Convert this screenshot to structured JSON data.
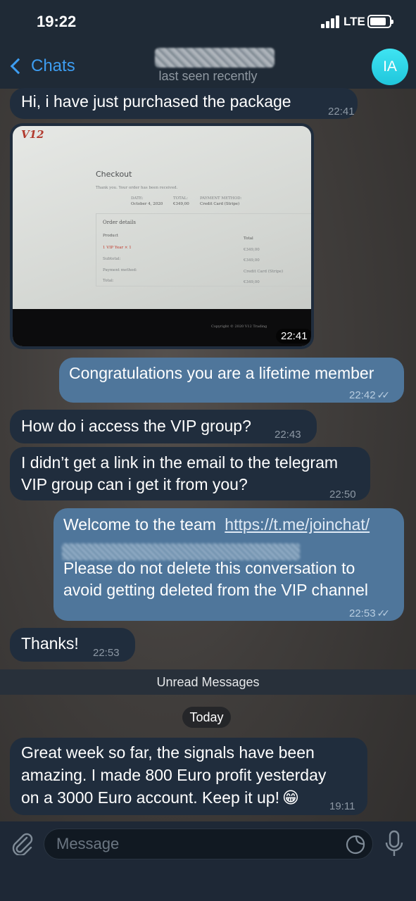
{
  "status_bar": {
    "time": "19:22",
    "network": "LTE"
  },
  "nav": {
    "back_label": "Chats",
    "subtitle": "last seen recently",
    "avatar_initials": "IA"
  },
  "messages": [
    {
      "dir": "in",
      "text": "Hi, i have just purchased the package",
      "time": "22:41"
    },
    {
      "dir": "in",
      "type": "photo",
      "time": "22:41",
      "photo": {
        "logo": "V12",
        "title": "Checkout",
        "thanks": "Thank you. Your order has been received.",
        "date_label": "DATE:",
        "date": "October 4, 2020",
        "total_label": "TOTAL:",
        "total": "€349,00",
        "payment_label": "PAYMENT METHOD:",
        "payment": "Credit Card (Stripe)",
        "order_details": "Order details",
        "product_hdr": "Product",
        "total_hdr": "Total",
        "item": "1 VIP Year × 1",
        "item_price": "€349,00",
        "subtotal_label": "Subtotal:",
        "subtotal": "€349,00",
        "pm_label": "Payment method:",
        "pm": "Credit Card (Stripe)",
        "grand_label": "Total:",
        "grand": "€349,00",
        "copyright": "Copyright © 2020 V12 Trading"
      }
    },
    {
      "dir": "out",
      "text": "Congratulations you are a lifetime member",
      "time": "22:42"
    },
    {
      "dir": "in",
      "text": "How do i access the VIP group?",
      "time": "22:43"
    },
    {
      "dir": "in",
      "line1": "I didn’t get a link in the email to the telegram",
      "line2": "VIP group can i get it from you?",
      "time": "22:50"
    },
    {
      "dir": "out",
      "prefix": "Welcome to the team",
      "link": "https://t.me/joinchat/",
      "line3": "Please do not delete this conversation to",
      "line4": "avoid getting deleted from the VIP channel",
      "time": "22:53"
    },
    {
      "dir": "in",
      "text": "Thanks!",
      "time": "22:53"
    },
    {
      "dir": "in",
      "line1": "Great week so far, the signals have been",
      "line2": "amazing. I made 800 Euro profit yesterday",
      "line3": "on a 3000 Euro account. Keep it up!",
      "emoji": "😁",
      "time": "19:11"
    }
  ],
  "unread_label": "Unread Messages",
  "date_separator": "Today",
  "composer": {
    "placeholder": "Message"
  },
  "colors": {
    "accent": "#3d9df1",
    "incoming_bubble": "#202d3d",
    "outgoing_bubble": "#4f769b",
    "header": "#1f2a36",
    "avatar": "#2bd3e6"
  }
}
